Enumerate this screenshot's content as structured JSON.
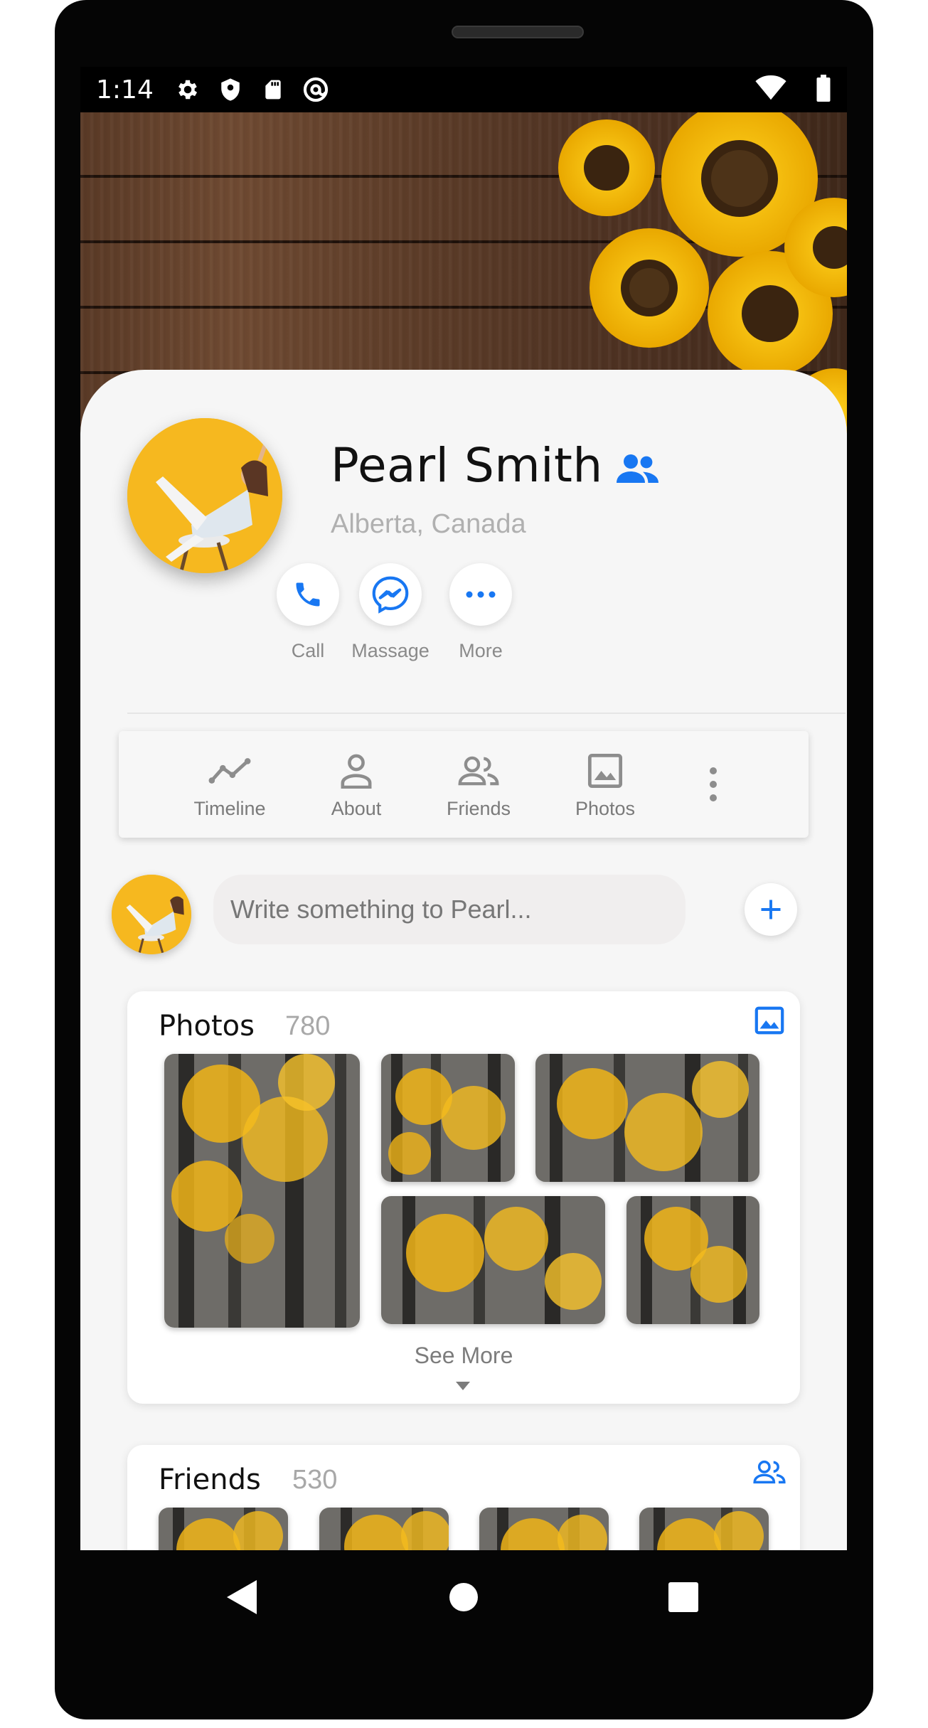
{
  "status_bar": {
    "time": "1:14",
    "left_icons": [
      "gear-icon",
      "shield-icon",
      "sd-card-icon",
      "at-sign-icon"
    ],
    "right_icons": [
      "wifi-icon",
      "battery-icon"
    ]
  },
  "profile": {
    "name": "Pearl Smith",
    "location": "Alberta, Canada",
    "accent_color": "#1877f2"
  },
  "actions": [
    {
      "label": "Call",
      "icon": "phone-icon"
    },
    {
      "label": "Massage",
      "icon": "messenger-icon"
    },
    {
      "label": "More",
      "icon": "more-dots-icon"
    }
  ],
  "tabs": [
    {
      "label": "Timeline",
      "icon": "timeline-icon"
    },
    {
      "label": "About",
      "icon": "person-icon"
    },
    {
      "label": "Friends",
      "icon": "people-icon"
    },
    {
      "label": "Photos",
      "icon": "image-icon"
    }
  ],
  "composer": {
    "placeholder": "Write something to Pearl..."
  },
  "photos_section": {
    "title": "Photos",
    "count": "780",
    "see_more": "See More"
  },
  "friends_section": {
    "title": "Friends",
    "count": "530"
  },
  "navigation": [
    "back-icon",
    "home-icon",
    "recents-icon"
  ]
}
